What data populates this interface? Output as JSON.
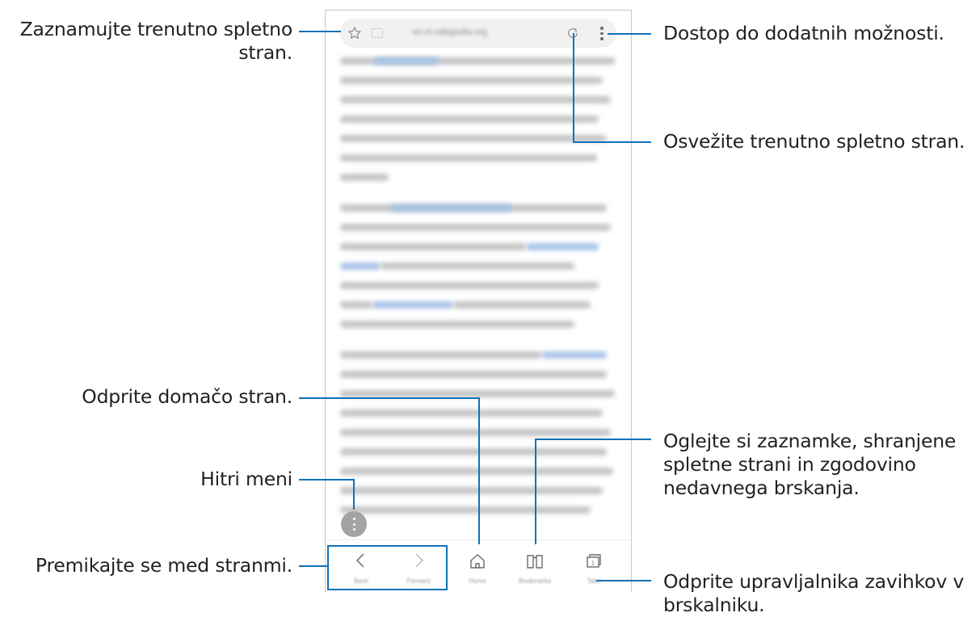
{
  "browser": {
    "url": "en.m.wikipedia.org",
    "nav": {
      "back": "Back",
      "forward": "Forward",
      "home": "Home",
      "bookmarks": "Bookmarks",
      "tabs": "Tabs",
      "tabs_count": "1"
    }
  },
  "callouts": {
    "bookmark": [
      "Zaznamujte trenutno spletno",
      "stran."
    ],
    "more_options": "Dostop do dodatnih možnosti.",
    "refresh": "Osvežite trenutno spletno stran.",
    "home": "Odprite domačo stran.",
    "bookmarks": [
      "Oglejte si zaznamke, shranjene",
      "spletne strani in zgodovino",
      "nedavnega brskanja."
    ],
    "quick_menu": "Hitri meni",
    "back_forward": "Premikajte se med stranmi.",
    "tabs": [
      "Odprite upravljalnika zavihkov v",
      "brskalniku."
    ]
  },
  "colors": {
    "accent": "#0f73b8",
    "text": "#231f20"
  },
  "icons": [
    "star-icon",
    "page-icon",
    "refresh-icon",
    "more-vert-icon",
    "quick-menu-icon",
    "back-arrow-icon",
    "forward-arrow-icon",
    "home-icon",
    "bookmarks-icon",
    "tabs-icon"
  ]
}
